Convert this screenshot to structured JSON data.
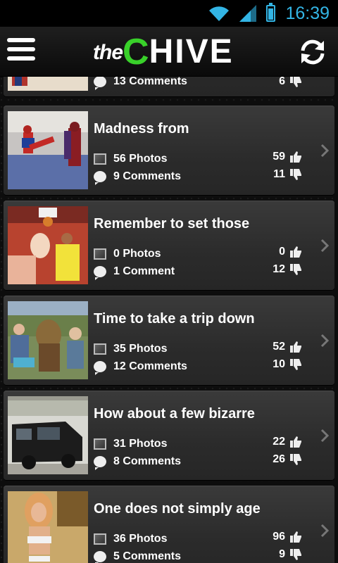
{
  "status": {
    "time": "16:39"
  },
  "header": {
    "logo_the": "the",
    "logo_c": "C",
    "logo_hive": "HIVE"
  },
  "cards": [
    {
      "title": "",
      "photos": "",
      "comments": "13 Comments",
      "likes": "",
      "dislikes": "6"
    },
    {
      "title": "Madness from",
      "photos": "56 Photos",
      "comments": "9 Comments",
      "likes": "59",
      "dislikes": "11"
    },
    {
      "title": "Remember to set those",
      "photos": "0 Photos",
      "comments": "1 Comment",
      "likes": "0",
      "dislikes": "12"
    },
    {
      "title": "Time to take a trip down",
      "photos": "35 Photos",
      "comments": "12 Comments",
      "likes": "52",
      "dislikes": "10"
    },
    {
      "title": "How about a few bizarre",
      "photos": "31 Photos",
      "comments": "8 Comments",
      "likes": "22",
      "dislikes": "26"
    },
    {
      "title": "One does not simply age",
      "photos": "36 Photos",
      "comments": "5 Comments",
      "likes": "96",
      "dislikes": "9"
    }
  ],
  "colors": {
    "accent": "#33b5e5",
    "brand_green": "#39d12a",
    "card": "#333333"
  },
  "icons": [
    "wifi-icon",
    "signal-icon",
    "battery-icon",
    "menu-icon",
    "refresh-icon",
    "photo-icon",
    "comment-icon",
    "thumbs-up-icon",
    "thumbs-down-icon",
    "chevron-right-icon"
  ]
}
